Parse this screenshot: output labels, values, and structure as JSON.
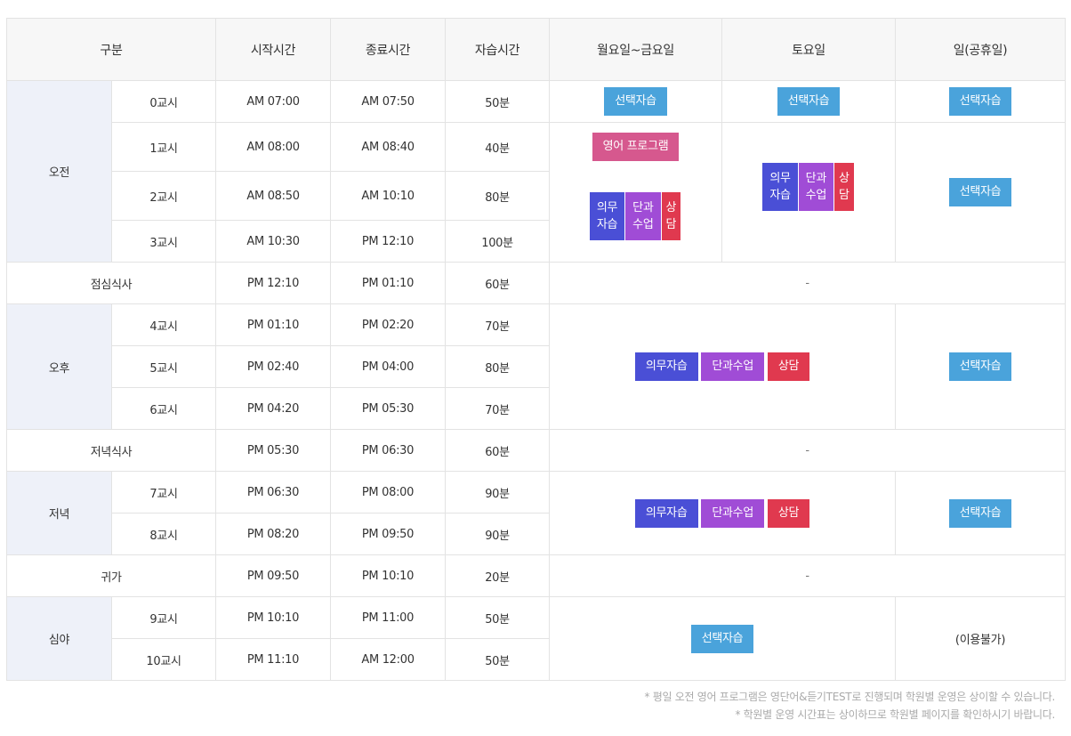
{
  "headers": [
    "구분",
    "시작시간",
    "종료시간",
    "자습시간",
    "월요일~금요일",
    "토요일",
    "일(공휴일)"
  ],
  "groups": {
    "morning": "오전",
    "afternoon": "오후",
    "evening": "저녁",
    "night": "심야"
  },
  "rows": [
    {
      "period": "0교시",
      "start": "AM 07:00",
      "end": "AM 07:50",
      "study": "50분"
    },
    {
      "period": "1교시",
      "start": "AM 08:00",
      "end": "AM 08:40",
      "study": "40분"
    },
    {
      "period": "2교시",
      "start": "AM 08:50",
      "end": "AM 10:10",
      "study": "80분"
    },
    {
      "period": "3교시",
      "start": "AM 10:30",
      "end": "PM 12:10",
      "study": "100분"
    },
    {
      "period": "점심식사",
      "start": "PM 12:10",
      "end": "PM 01:10",
      "study": "60분"
    },
    {
      "period": "4교시",
      "start": "PM 01:10",
      "end": "PM 02:20",
      "study": "70분"
    },
    {
      "period": "5교시",
      "start": "PM 02:40",
      "end": "PM 04:00",
      "study": "80분"
    },
    {
      "period": "6교시",
      "start": "PM 04:20",
      "end": "PM 05:30",
      "study": "70분"
    },
    {
      "period": "저녁식사",
      "start": "PM 05:30",
      "end": "PM 06:30",
      "study": "60분"
    },
    {
      "period": "7교시",
      "start": "PM 06:30",
      "end": "PM 08:00",
      "study": "90분"
    },
    {
      "period": "8교시",
      "start": "PM 08:20",
      "end": "PM 09:50",
      "study": "90분"
    },
    {
      "period": "귀가",
      "start": "PM 09:50",
      "end": "PM 10:10",
      "study": "20분"
    },
    {
      "period": "9교시",
      "start": "PM 10:10",
      "end": "PM 11:00",
      "study": "50분"
    },
    {
      "period": "10교시",
      "start": "PM 11:10",
      "end": "AM 12:00",
      "study": "50분"
    }
  ],
  "labels": {
    "elective": "선택자습",
    "english": "영어 프로그램",
    "mandatory": "의무자습",
    "single_class": "단과수업",
    "consult": "상담",
    "mandatory_split": "의무\n자습",
    "single_split": "단과\n수업",
    "consult_split": "상\n담",
    "dash": "-",
    "unavailable": "(이용불가)"
  },
  "notes": [
    "* 평일 오전 영어 프로그램은 영단어&듣기TEST로 진행되며 학원별 운영은 상이할 수 있습니다.",
    "* 학원별 운영 시간표는 상이하므로 학원별 페이지를 확인하시기 바랍니다."
  ],
  "colors": {
    "elective": "#4aa3db",
    "english": "#d6588e",
    "mandatory": "#4a4fd6",
    "single_class": "#a04cd6",
    "consult": "#e0394f"
  }
}
